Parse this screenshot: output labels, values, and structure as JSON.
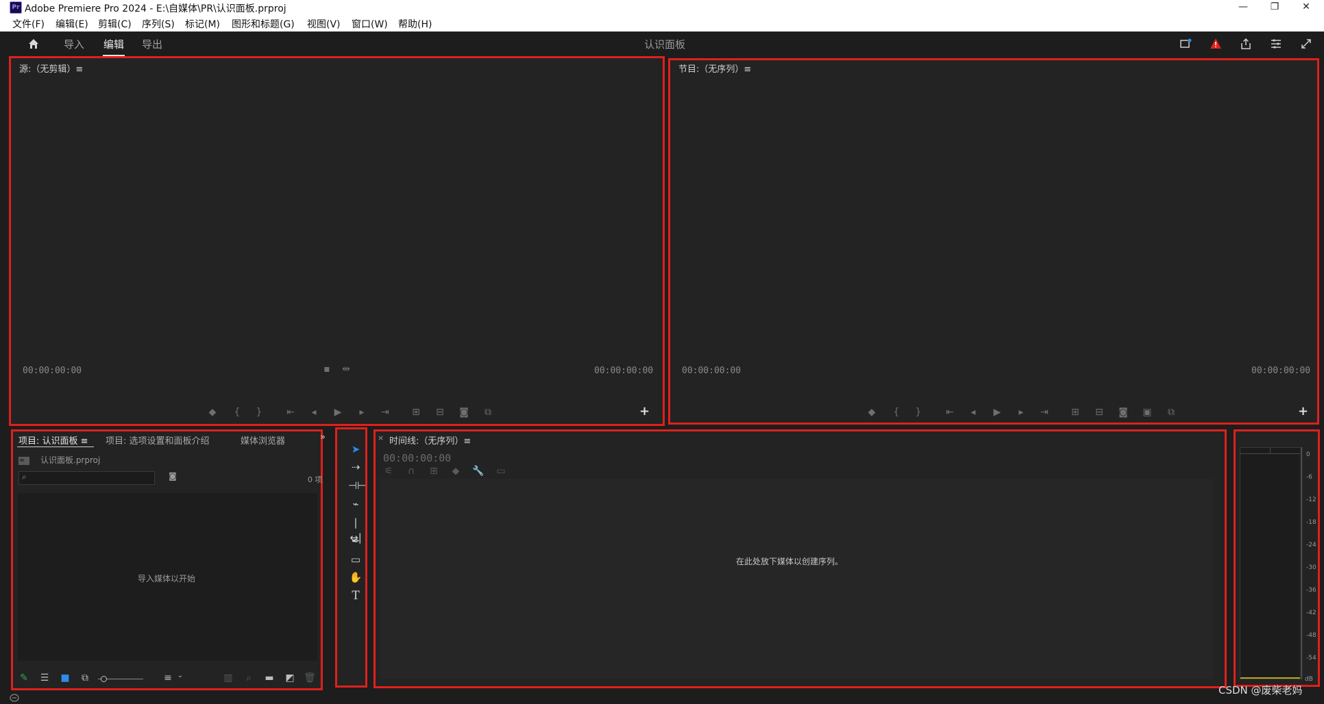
{
  "window": {
    "title": "Adobe Premiere Pro 2024 - E:\\自媒体\\PR\\认识面板.prproj",
    "app_icon": "Pr",
    "controls": [
      "—",
      "❐",
      "✕"
    ]
  },
  "menu": {
    "items": [
      "文件(F)",
      "编辑(E)",
      "剪辑(C)",
      "序列(S)",
      "标记(M)",
      "图形和标题(G)",
      "视图(V)",
      "窗口(W)",
      "帮助(H)"
    ]
  },
  "workspace": {
    "tabs": [
      {
        "label": "导入",
        "active": false
      },
      {
        "label": "编辑",
        "active": true
      },
      {
        "label": "导出",
        "active": false
      }
    ],
    "center_title": "认识面板",
    "accent": "#e0201c"
  },
  "source_monitor": {
    "title": "源:（无剪辑）≡",
    "tc_left": "00:00:00:00",
    "tc_right": "00:00:00:00"
  },
  "program_monitor": {
    "title": "节目:（无序列）≡",
    "tc_left": "00:00:00:00",
    "tc_right": "00:00:00:00"
  },
  "project": {
    "tabs": [
      "项目: 认识面板  ≡",
      "项目: 选项设置和面板介绍",
      "媒体浏览器"
    ],
    "overflow": "»",
    "file_name": "认识面板.prproj",
    "item_count": "0 项",
    "empty_text": "导入媒体以开始"
  },
  "timeline": {
    "close": "×",
    "title": "时间线:（无序列）≡",
    "timecode": "00:00:00:00",
    "empty_text": "在此处放下媒体以创建序列。"
  },
  "audio_meter": {
    "labels": [
      "0",
      "-6",
      "-12",
      "-18",
      "-24",
      "-30",
      "-36",
      "-42",
      "-48",
      "-54",
      "dB"
    ]
  },
  "watermark": "CSDN @废柴老妈"
}
